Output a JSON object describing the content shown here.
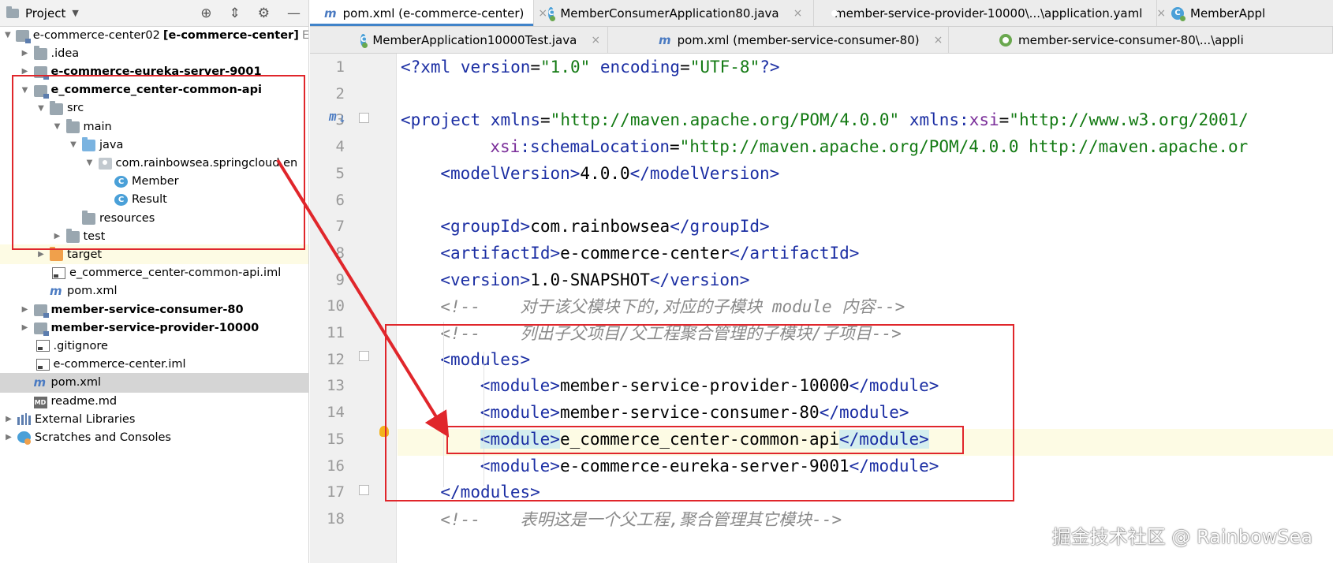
{
  "project_panel": {
    "title": "Project",
    "tree": [
      {
        "label": "e-commerce-center02",
        "tail": "[e-commerce-center]",
        "suffix": "E",
        "icon": "module-icon",
        "arrow": "down",
        "indent": 0
      },
      {
        "label": ".idea",
        "icon": "folder-icon",
        "arrow": "right",
        "indent": 1
      },
      {
        "label": "e-commerce-eureka-server-9001",
        "icon": "module-icon",
        "arrow": "right",
        "indent": 1,
        "bold": true
      },
      {
        "label": "e_commerce_center-common-api",
        "icon": "module-icon",
        "arrow": "down",
        "indent": 1,
        "bold": true
      },
      {
        "label": "src",
        "icon": "folder-icon",
        "arrow": "down",
        "indent": 2
      },
      {
        "label": "main",
        "icon": "folder-icon",
        "arrow": "down",
        "indent": 3
      },
      {
        "label": "java",
        "icon": "source-folder-icon",
        "arrow": "down",
        "indent": 4
      },
      {
        "label": "com.rainbowsea.springcloud.en",
        "icon": "package-icon",
        "arrow": "down",
        "indent": 5
      },
      {
        "label": "Member",
        "icon": "class-icon",
        "arrow": "",
        "indent": 6
      },
      {
        "label": "Result",
        "icon": "class-icon",
        "arrow": "",
        "indent": 6
      },
      {
        "label": "resources",
        "icon": "resources-folder-icon",
        "arrow": "",
        "indent": 4
      },
      {
        "label": "test",
        "icon": "folder-icon",
        "arrow": "right",
        "indent": 3
      },
      {
        "label": "target",
        "icon": "target-folder-icon",
        "arrow": "right",
        "indent": 2,
        "highlight": "yellow"
      },
      {
        "label": "e_commerce_center-common-api.iml",
        "icon": "iml-file-icon",
        "arrow": "",
        "indent": 2
      },
      {
        "label": "pom.xml",
        "icon": "maven-icon",
        "arrow": "",
        "indent": 2
      },
      {
        "label": "member-service-consumer-80",
        "icon": "module-icon",
        "arrow": "right",
        "indent": 1,
        "bold": true
      },
      {
        "label": "member-service-provider-10000",
        "icon": "module-icon",
        "arrow": "right",
        "indent": 1,
        "bold": true
      },
      {
        "label": ".gitignore",
        "icon": "file-icon",
        "arrow": "",
        "indent": 1
      },
      {
        "label": "e-commerce-center.iml",
        "icon": "iml-file-icon",
        "arrow": "",
        "indent": 1
      },
      {
        "label": "pom.xml",
        "icon": "maven-icon",
        "arrow": "",
        "indent": 1,
        "highlight": "grey"
      },
      {
        "label": "readme.md",
        "icon": "markdown-icon",
        "arrow": "",
        "indent": 1
      },
      {
        "label": "External Libraries",
        "icon": "libraries-icon",
        "arrow": "right",
        "indent": 0
      },
      {
        "label": "Scratches and Consoles",
        "icon": "scratches-icon",
        "arrow": "right",
        "indent": 0
      }
    ]
  },
  "tabs_row1": [
    {
      "label": "pom.xml (e-commerce-center)",
      "icon": "maven-icon",
      "active": true
    },
    {
      "label": "MemberConsumerApplication80.java",
      "icon": "class-icon"
    },
    {
      "label": "member-service-provider-10000\\...\\application.yaml",
      "icon": "yaml-icon"
    },
    {
      "label": "MemberAppl",
      "icon": "class-icon"
    }
  ],
  "tabs_row2": [
    {
      "label": "MemberApplication10000Test.java",
      "icon": "class-icon"
    },
    {
      "label": "pom.xml (member-service-consumer-80)",
      "icon": "maven-icon"
    },
    {
      "label": "member-service-consumer-80\\...\\appli",
      "icon": "yaml-icon"
    }
  ],
  "editor": {
    "gutter_mark": "m",
    "lines": [
      {
        "n": "1",
        "indent": 0,
        "tokens": [
          [
            "pi",
            "<?xml "
          ],
          [
            "attr",
            "version"
          ],
          [
            "text",
            "="
          ],
          [
            "val",
            "\"1.0\""
          ],
          [
            "text",
            " "
          ],
          [
            "attr",
            "encoding"
          ],
          [
            "text",
            "="
          ],
          [
            "val",
            "\"UTF-8\""
          ],
          [
            "pi",
            "?>"
          ]
        ]
      },
      {
        "n": "2",
        "indent": 0,
        "tokens": []
      },
      {
        "n": "3",
        "indent": 0,
        "tokens": [
          [
            "tag",
            "<project "
          ],
          [
            "attr",
            "xmlns"
          ],
          [
            "text",
            "="
          ],
          [
            "val",
            "\"http://maven.apache.org/POM/4.0.0\""
          ],
          [
            "text",
            " "
          ],
          [
            "attr",
            "xmlns:"
          ],
          [
            "ns",
            "xsi"
          ],
          [
            "text",
            "="
          ],
          [
            "val",
            "\"http://www.w3.org/2001/"
          ]
        ]
      },
      {
        "n": "4",
        "indent": 9,
        "tokens": [
          [
            "ns",
            "xsi"
          ],
          [
            "attr",
            ":schemaLocation"
          ],
          [
            "text",
            "="
          ],
          [
            "val",
            "\"http://maven.apache.org/POM/4.0.0 http://maven.apache.or"
          ]
        ]
      },
      {
        "n": "5",
        "indent": 4,
        "tokens": [
          [
            "tag",
            "<modelVersion>"
          ],
          [
            "text",
            "4.0.0"
          ],
          [
            "tag",
            "</modelVersion>"
          ]
        ]
      },
      {
        "n": "6",
        "indent": 0,
        "tokens": []
      },
      {
        "n": "7",
        "indent": 4,
        "tokens": [
          [
            "tag",
            "<groupId>"
          ],
          [
            "text",
            "com.rainbowsea"
          ],
          [
            "tag",
            "</groupId>"
          ]
        ]
      },
      {
        "n": "8",
        "indent": 4,
        "tokens": [
          [
            "tag",
            "<artifactId>"
          ],
          [
            "text",
            "e-commerce-center"
          ],
          [
            "tag",
            "</artifactId>"
          ]
        ]
      },
      {
        "n": "9",
        "indent": 4,
        "tokens": [
          [
            "tag",
            "<version>"
          ],
          [
            "text",
            "1.0-SNAPSHOT"
          ],
          [
            "tag",
            "</version>"
          ]
        ]
      },
      {
        "n": "10",
        "indent": 4,
        "tokens": [
          [
            "comment",
            "<!--    对于该父模块下的,对应的子模块 module 内容-->"
          ]
        ]
      },
      {
        "n": "11",
        "indent": 4,
        "tokens": [
          [
            "comment",
            "<!--    列出子父项目/父工程聚合管理的子模块/子项目-->"
          ]
        ]
      },
      {
        "n": "12",
        "indent": 4,
        "tokens": [
          [
            "tag",
            "<modules>"
          ]
        ]
      },
      {
        "n": "13",
        "indent": 8,
        "tokens": [
          [
            "tag",
            "<module>"
          ],
          [
            "text",
            "member-service-provider-10000"
          ],
          [
            "tag",
            "</module>"
          ]
        ]
      },
      {
        "n": "14",
        "indent": 8,
        "tokens": [
          [
            "tag",
            "<module>"
          ],
          [
            "text",
            "member-service-consumer-80"
          ],
          [
            "tag",
            "</module>"
          ]
        ]
      },
      {
        "n": "15",
        "indent": 8,
        "tokens": [
          [
            "taghl",
            "<module>"
          ],
          [
            "text",
            "e_commerce_center-common-api"
          ],
          [
            "taghl",
            "</module>"
          ]
        ]
      },
      {
        "n": "16",
        "indent": 8,
        "tokens": [
          [
            "tag",
            "<module>"
          ],
          [
            "text",
            "e-commerce-eureka-server-9001"
          ],
          [
            "tag",
            "</module>"
          ]
        ]
      },
      {
        "n": "17",
        "indent": 4,
        "tokens": [
          [
            "tag",
            "</modules>"
          ]
        ]
      },
      {
        "n": "18",
        "indent": 4,
        "tokens": [
          [
            "comment",
            "<!--    表明这是一个父工程,聚合管理其它模块-->"
          ]
        ]
      }
    ]
  },
  "colors": {
    "annotation": "#e0262b",
    "tab_active_underline": "#4083c9",
    "xml_tag": "#1b2ea3",
    "xml_value": "#137a13",
    "comment": "#8a8a8a"
  },
  "watermark": "掘金技术社区 @ RainbowSea"
}
